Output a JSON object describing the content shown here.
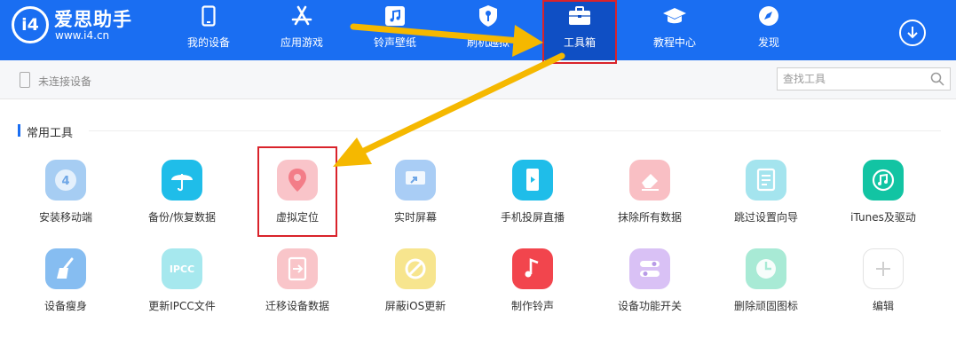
{
  "app": {
    "name": "爱思助手",
    "url": "www.i4.cn",
    "logo_text": "i4"
  },
  "nav": [
    {
      "label": "我的设备",
      "icon": "phone-icon"
    },
    {
      "label": "应用游戏",
      "icon": "app-store-icon"
    },
    {
      "label": "铃声壁纸",
      "icon": "music-icon"
    },
    {
      "label": "刷机越狱",
      "icon": "shield-key-icon"
    },
    {
      "label": "工具箱",
      "icon": "toolbox-icon",
      "active": true
    },
    {
      "label": "教程中心",
      "icon": "graduation-cap-icon"
    },
    {
      "label": "发现",
      "icon": "compass-icon"
    }
  ],
  "device": {
    "status": "未连接设备"
  },
  "search": {
    "placeholder": "查找工具"
  },
  "section": {
    "title": "常用工具"
  },
  "tools": [
    {
      "label": "安装移动端",
      "icon": "install-mobile-icon",
      "color": "#a6cdf3"
    },
    {
      "label": "备份/恢复数据",
      "icon": "umbrella-icon",
      "color": "#1fbde9"
    },
    {
      "label": "虚拟定位",
      "icon": "location-pin-icon",
      "color": "#f9c4c9",
      "highlighted": true
    },
    {
      "label": "实时屏幕",
      "icon": "screen-mirror-icon",
      "color": "#a9cdf5"
    },
    {
      "label": "手机投屏直播",
      "icon": "phone-cast-icon",
      "color": "#1fbde9"
    },
    {
      "label": "抹除所有数据",
      "icon": "eraser-icon",
      "color": "#f9bfc4"
    },
    {
      "label": "跳过设置向导",
      "icon": "skip-setup-icon",
      "color": "#a4e4ee"
    },
    {
      "label": "iTunes及驱动",
      "icon": "itunes-icon",
      "color": "#12c4a3"
    },
    {
      "label": "设备瘦身",
      "icon": "broom-icon",
      "color": "#86bdf1"
    },
    {
      "label": "更新IPCC文件",
      "icon": "ipcc-icon",
      "color": "#a6e8ee",
      "text": "IPCC"
    },
    {
      "label": "迁移设备数据",
      "icon": "migrate-data-icon",
      "color": "#f9c5c9"
    },
    {
      "label": "屏蔽iOS更新",
      "icon": "block-update-icon",
      "color": "#f7e58e"
    },
    {
      "label": "制作铃声",
      "icon": "ringtone-note-icon",
      "color": "#f2454d"
    },
    {
      "label": "设备功能开关",
      "icon": "toggle-switch-icon",
      "color": "#d9c1f5"
    },
    {
      "label": "删除顽固图标",
      "icon": "delete-icon-icon",
      "color": "#a8ead5"
    },
    {
      "label": "编辑",
      "icon": "plus-icon",
      "color": "#ffffff"
    }
  ],
  "colors": {
    "header": "#1a6ef2",
    "highlight": "#d9232b",
    "arrow": "#f5b800"
  }
}
